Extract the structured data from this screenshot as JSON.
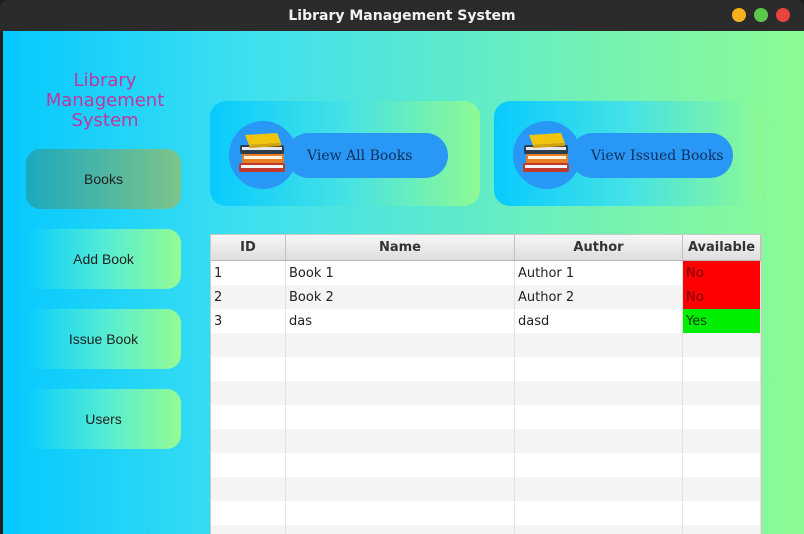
{
  "window": {
    "title": "Library Management System"
  },
  "sidebar": {
    "brand_lines": [
      "Library",
      "Management",
      "System"
    ],
    "items": [
      {
        "label": "Books",
        "active": true
      },
      {
        "label": "Add Book",
        "active": false
      },
      {
        "label": "Issue Book",
        "active": false
      },
      {
        "label": "Users",
        "active": false
      }
    ]
  },
  "actions": {
    "view_all_books": "View All Books",
    "view_issued_books": "View Issued Books"
  },
  "table": {
    "columns": [
      "ID",
      "Name",
      "Author",
      "Available"
    ],
    "rows": [
      {
        "id": "1",
        "name": "Book 1",
        "author": "Author 1",
        "available": "No"
      },
      {
        "id": "2",
        "name": "Book 2",
        "author": "Author 2",
        "available": "No"
      },
      {
        "id": "3",
        "name": "das",
        "author": "dasd",
        "available": "Yes"
      }
    ]
  },
  "colors": {
    "brand_text": "#c0359e",
    "pill_blue": "#2997f5",
    "available_no": "#ff0000",
    "available_yes": "#00ee00"
  }
}
